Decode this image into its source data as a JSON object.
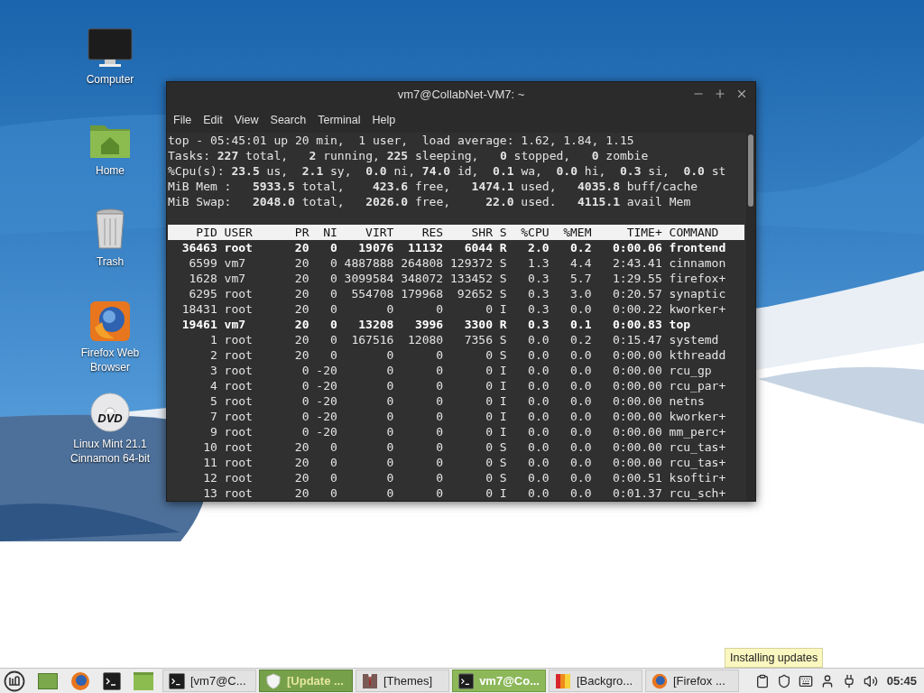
{
  "desktop": {
    "icons": [
      {
        "kind": "computer",
        "label": "Computer"
      },
      {
        "kind": "home",
        "label": "Home"
      },
      {
        "kind": "trash",
        "label": "Trash"
      },
      {
        "kind": "firefox",
        "label": "Firefox Web Browser"
      },
      {
        "kind": "dvd",
        "label": "Linux Mint 21.1 Cinnamon 64-bit",
        "disc_text": "DVD"
      }
    ]
  },
  "terminal": {
    "title": "vm7@CollabNet-VM7: ~",
    "menu": [
      "File",
      "Edit",
      "View",
      "Search",
      "Terminal",
      "Help"
    ],
    "summary": [
      "top - 05:45:01 up 20 min,  1 user,  load average: 1.62, 1.84, 1.15",
      "Tasks: **227** total,   **2** running, **225** sleeping,   **0** stopped,   **0** zombie",
      "%Cpu(s): **23.5** us,  **2.1** sy,  **0.0** ni, **74.0** id,  **0.1** wa,  **0.0** hi,  **0.3** si,  **0.0** st",
      "MiB Mem :   **5933.5** total,    **423.6** free,   **1474.1** used,   **4035.8** buff/cache",
      "MiB Swap:   **2048.0** total,   **2026.0** free,     **22.0** used.   **4115.1** avail Mem"
    ],
    "columns": [
      "PID",
      "USER",
      "PR",
      "NI",
      "VIRT",
      "RES",
      "SHR",
      "S",
      "%CPU",
      "%MEM",
      "TIME+",
      "COMMAND"
    ],
    "rows": [
      {
        "bold": true,
        "cells": [
          "36463",
          "root",
          "20",
          "0",
          "19076",
          "11132",
          "6044",
          "R",
          "2.0",
          "0.2",
          "0:00.06",
          "frontend"
        ]
      },
      {
        "bold": false,
        "cells": [
          "6599",
          "vm7",
          "20",
          "0",
          "4887888",
          "264808",
          "129372",
          "S",
          "1.3",
          "4.4",
          "2:43.41",
          "cinnamon"
        ]
      },
      {
        "bold": false,
        "cells": [
          "1628",
          "vm7",
          "20",
          "0",
          "3099584",
          "348072",
          "133452",
          "S",
          "0.3",
          "5.7",
          "1:29.55",
          "firefox+"
        ]
      },
      {
        "bold": false,
        "cells": [
          "6295",
          "root",
          "20",
          "0",
          "554708",
          "179968",
          "92652",
          "S",
          "0.3",
          "3.0",
          "0:20.57",
          "synaptic"
        ]
      },
      {
        "bold": false,
        "cells": [
          "18431",
          "root",
          "20",
          "0",
          "0",
          "0",
          "0",
          "I",
          "0.3",
          "0.0",
          "0:00.22",
          "kworker+"
        ]
      },
      {
        "bold": true,
        "cells": [
          "19461",
          "vm7",
          "20",
          "0",
          "13208",
          "3996",
          "3300",
          "R",
          "0.3",
          "0.1",
          "0:00.83",
          "top"
        ]
      },
      {
        "bold": false,
        "cells": [
          "1",
          "root",
          "20",
          "0",
          "167516",
          "12080",
          "7356",
          "S",
          "0.0",
          "0.2",
          "0:15.47",
          "systemd"
        ]
      },
      {
        "bold": false,
        "cells": [
          "2",
          "root",
          "20",
          "0",
          "0",
          "0",
          "0",
          "S",
          "0.0",
          "0.0",
          "0:00.00",
          "kthreadd"
        ]
      },
      {
        "bold": false,
        "cells": [
          "3",
          "root",
          "0",
          "-20",
          "0",
          "0",
          "0",
          "I",
          "0.0",
          "0.0",
          "0:00.00",
          "rcu_gp"
        ]
      },
      {
        "bold": false,
        "cells": [
          "4",
          "root",
          "0",
          "-20",
          "0",
          "0",
          "0",
          "I",
          "0.0",
          "0.0",
          "0:00.00",
          "rcu_par+"
        ]
      },
      {
        "bold": false,
        "cells": [
          "5",
          "root",
          "0",
          "-20",
          "0",
          "0",
          "0",
          "I",
          "0.0",
          "0.0",
          "0:00.00",
          "netns"
        ]
      },
      {
        "bold": false,
        "cells": [
          "7",
          "root",
          "0",
          "-20",
          "0",
          "0",
          "0",
          "I",
          "0.0",
          "0.0",
          "0:00.00",
          "kworker+"
        ]
      },
      {
        "bold": false,
        "cells": [
          "9",
          "root",
          "0",
          "-20",
          "0",
          "0",
          "0",
          "I",
          "0.0",
          "0.0",
          "0:00.00",
          "mm_perc+"
        ]
      },
      {
        "bold": false,
        "cells": [
          "10",
          "root",
          "20",
          "0",
          "0",
          "0",
          "0",
          "S",
          "0.0",
          "0.0",
          "0:00.00",
          "rcu_tas+"
        ]
      },
      {
        "bold": false,
        "cells": [
          "11",
          "root",
          "20",
          "0",
          "0",
          "0",
          "0",
          "S",
          "0.0",
          "0.0",
          "0:00.00",
          "rcu_tas+"
        ]
      },
      {
        "bold": false,
        "cells": [
          "12",
          "root",
          "20",
          "0",
          "0",
          "0",
          "0",
          "S",
          "0.0",
          "0.0",
          "0:00.51",
          "ksoftir+"
        ]
      },
      {
        "bold": false,
        "cells": [
          "13",
          "root",
          "20",
          "0",
          "0",
          "0",
          "0",
          "I",
          "0.0",
          "0.0",
          "0:01.37",
          "rcu_sch+"
        ]
      }
    ]
  },
  "tooltip": "Installing updates",
  "taskbar": {
    "launchers": [
      {
        "kind": "menu"
      },
      {
        "kind": "show-desktop"
      },
      {
        "kind": "firefox"
      },
      {
        "kind": "terminal"
      },
      {
        "kind": "files"
      }
    ],
    "windows": [
      {
        "kind": "terminal",
        "label": "[vm7@C...",
        "selected": false,
        "attention": false
      },
      {
        "kind": "shield",
        "label": "[Update ...",
        "selected": false,
        "attention": true
      },
      {
        "kind": "themes",
        "label": "[Themes]",
        "selected": false,
        "attention": false
      },
      {
        "kind": "terminal",
        "label": "vm7@Co...",
        "selected": true,
        "attention": false
      },
      {
        "kind": "background",
        "label": "[Backgro...",
        "selected": false,
        "attention": false
      },
      {
        "kind": "firefox",
        "label": "[Firefox ...",
        "selected": false,
        "attention": false
      }
    ],
    "tray": [
      {
        "kind": "clipboard"
      },
      {
        "kind": "shield"
      },
      {
        "kind": "keyboard"
      },
      {
        "kind": "user"
      },
      {
        "kind": "cable"
      },
      {
        "kind": "volume"
      }
    ],
    "clock": "05:45"
  }
}
